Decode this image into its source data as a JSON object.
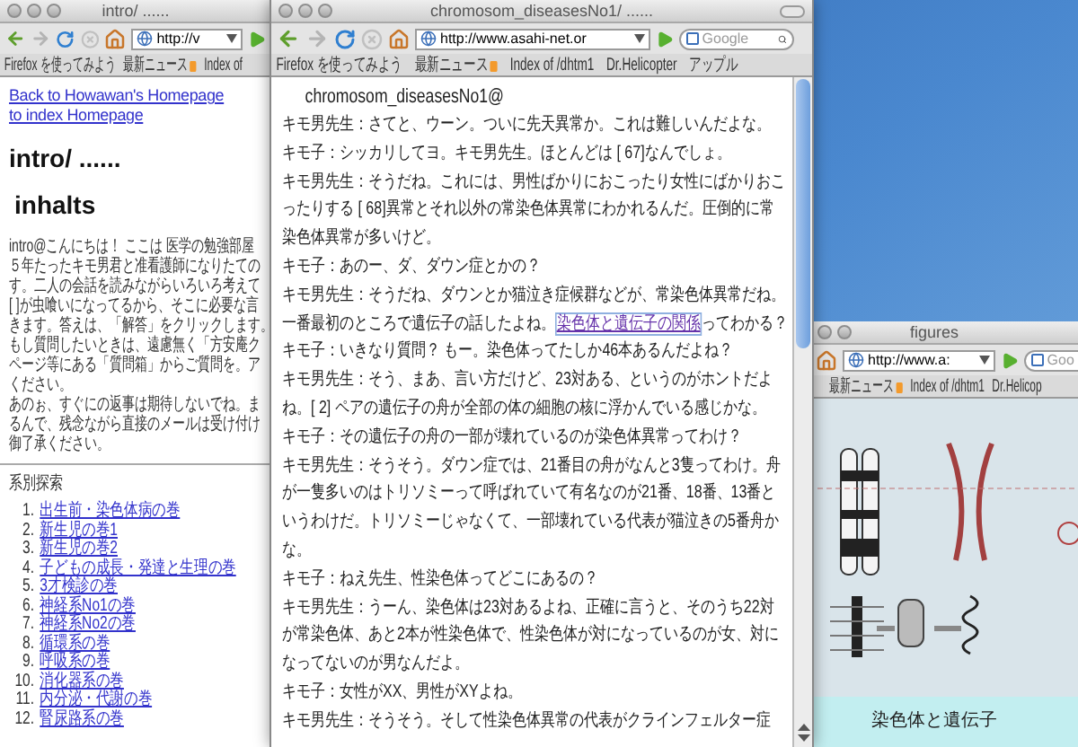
{
  "intro_window": {
    "title": "intro/ ......",
    "url": "http://v",
    "bookmarks": [
      {
        "label": "Firefox を使ってみよう",
        "kind": "link"
      },
      {
        "label": "最新ニュース",
        "kind": "feed"
      },
      {
        "label": "Index of",
        "kind": "link"
      }
    ],
    "links": [
      "Back to Howawan's Homepage",
      "to index Homepage"
    ],
    "heading": "intro/ ......",
    "subheading": "inhalts",
    "intro_lines": [
      "intro@こんにちは！ ここは 医学の勉強部屋",
      "５年たったキモ男君と准看護師になりたての",
      "す。二人の会話を読みながらいろいろ考えて",
      "[ ]が虫喰いになってるから、そこに必要な言",
      "きます。答えは、「解答」をクリックします。",
      "もし質問したいときは、遠慮無く「方安庵ク",
      "ページ等にある「質問箱」からご質問を。ア",
      "ください。",
      "あのぉ、すぐにの返事は期待しないでね。ま",
      "るんで、残念ながら直接のメールは受け付け",
      "御了承ください。"
    ],
    "section_title": "系別探索",
    "list": [
      {
        "number": "1.",
        "label": "出生前・染色体病の巻"
      },
      {
        "number": "2.",
        "label": "新生児の巻1"
      },
      {
        "number": "3.",
        "label": "新生児の巻2"
      },
      {
        "number": "4.",
        "label": "子どもの成長・発達と生理の巻"
      },
      {
        "number": "5.",
        "label": "3才検診の巻"
      },
      {
        "number": "6.",
        "label": "神経系No1の巻"
      },
      {
        "number": "7.",
        "label": "神経系No2の巻"
      },
      {
        "number": "8.",
        "label": "循環系の巻"
      },
      {
        "number": "9.",
        "label": "呼吸系の巻"
      },
      {
        "number": "10.",
        "label": "消化器系の巻"
      },
      {
        "number": "11.",
        "label": "内分泌・代謝の巻"
      },
      {
        "number": "12.",
        "label": "腎尿路系の巻"
      }
    ]
  },
  "article_window": {
    "title": "chromosom_diseasesNo1/ ......",
    "url": "http://www.asahi-net.or",
    "search_placeholder": "Google",
    "bookmarks": [
      {
        "label": "Firefox を使ってみよう",
        "kind": "link"
      },
      {
        "label": "最新ニュース",
        "kind": "feed"
      },
      {
        "label": "Index of /dhtm1",
        "kind": "link"
      },
      {
        "label": "Dr.Helicopter",
        "kind": "link"
      },
      {
        "label": "アップル",
        "kind": "link"
      }
    ],
    "heading": "chromosom_diseasesNo1@",
    "paragraphs": [
      {
        "text": "キモ男先生：さてと、ウーン。ついに先天異常か。これは難しいんだよな。"
      },
      {
        "text": "キモ子：シッカリしてヨ。キモ男先生。ほとんどは [ 67]なんでしょ。"
      },
      {
        "text": "キモ男先生：そうだね。これには、男性ばかりにおこったり女性にばかりおこったりする [ 68]異常とそれ以外の常染色体異常にわかれるんだ。圧倒的に常染色体異常が多いけど。"
      },
      {
        "text": "キモ子：あのー、ダ、ダウン症とかの？"
      },
      {
        "text": "キモ男先生：そうだね、ダウンとか猫泣き症候群などが、常染色体異常だね。一番最初のところで遺伝子の話したよね。",
        "link": "染色体と遺伝子の関係",
        "after": "ってわかる？"
      },
      {
        "text": "キモ子：いきなり質問？ もー。染色体ってたしか46本あるんだよね？"
      },
      {
        "text": "キモ男先生：そう、まあ、言い方だけど、23対ある、というのがホントだよね。[ 2] ペアの遺伝子の舟が全部の体の細胞の核に浮かんでいる感じかな。"
      },
      {
        "text": "キモ子：その遺伝子の舟の一部が壊れているのが染色体異常ってわけ？"
      },
      {
        "text": "キモ男先生：そうそう。ダウン症では、21番目の舟がなんと3隻ってわけ。舟が一隻多いのはトリソミーって呼ばれていて有名なのが21番、18番、13番というわけだ。トリソミーじゃなくて、一部壊れている代表が猫泣きの5番舟かな。"
      },
      {
        "text": "キモ子：ねえ先生、性染色体ってどこにあるの？"
      },
      {
        "text": "キモ男先生：うーん、染色体は23対あるよね、正確に言うと、そのうち22対が常染色体、あと2本が性染色体で、性染色体が対になっているのが女、対になってないのが男なんだよ。"
      },
      {
        "text": "キモ子：女性がXX、男性がXYよね。"
      },
      {
        "text": "キモ男先生：そうそう。そして性染色体異常の代表がクラインフェルター症"
      }
    ]
  },
  "figures_window": {
    "title": "figures",
    "url": "http://www.a:",
    "search_placeholder": "Goo",
    "bookmarks": [
      {
        "label": "最新ニュース",
        "kind": "feed"
      },
      {
        "label": "Index of /dhtm1",
        "kind": "link"
      },
      {
        "label": "Dr.Helicop",
        "kind": "link"
      }
    ],
    "caption": "染色体と遺伝子"
  }
}
